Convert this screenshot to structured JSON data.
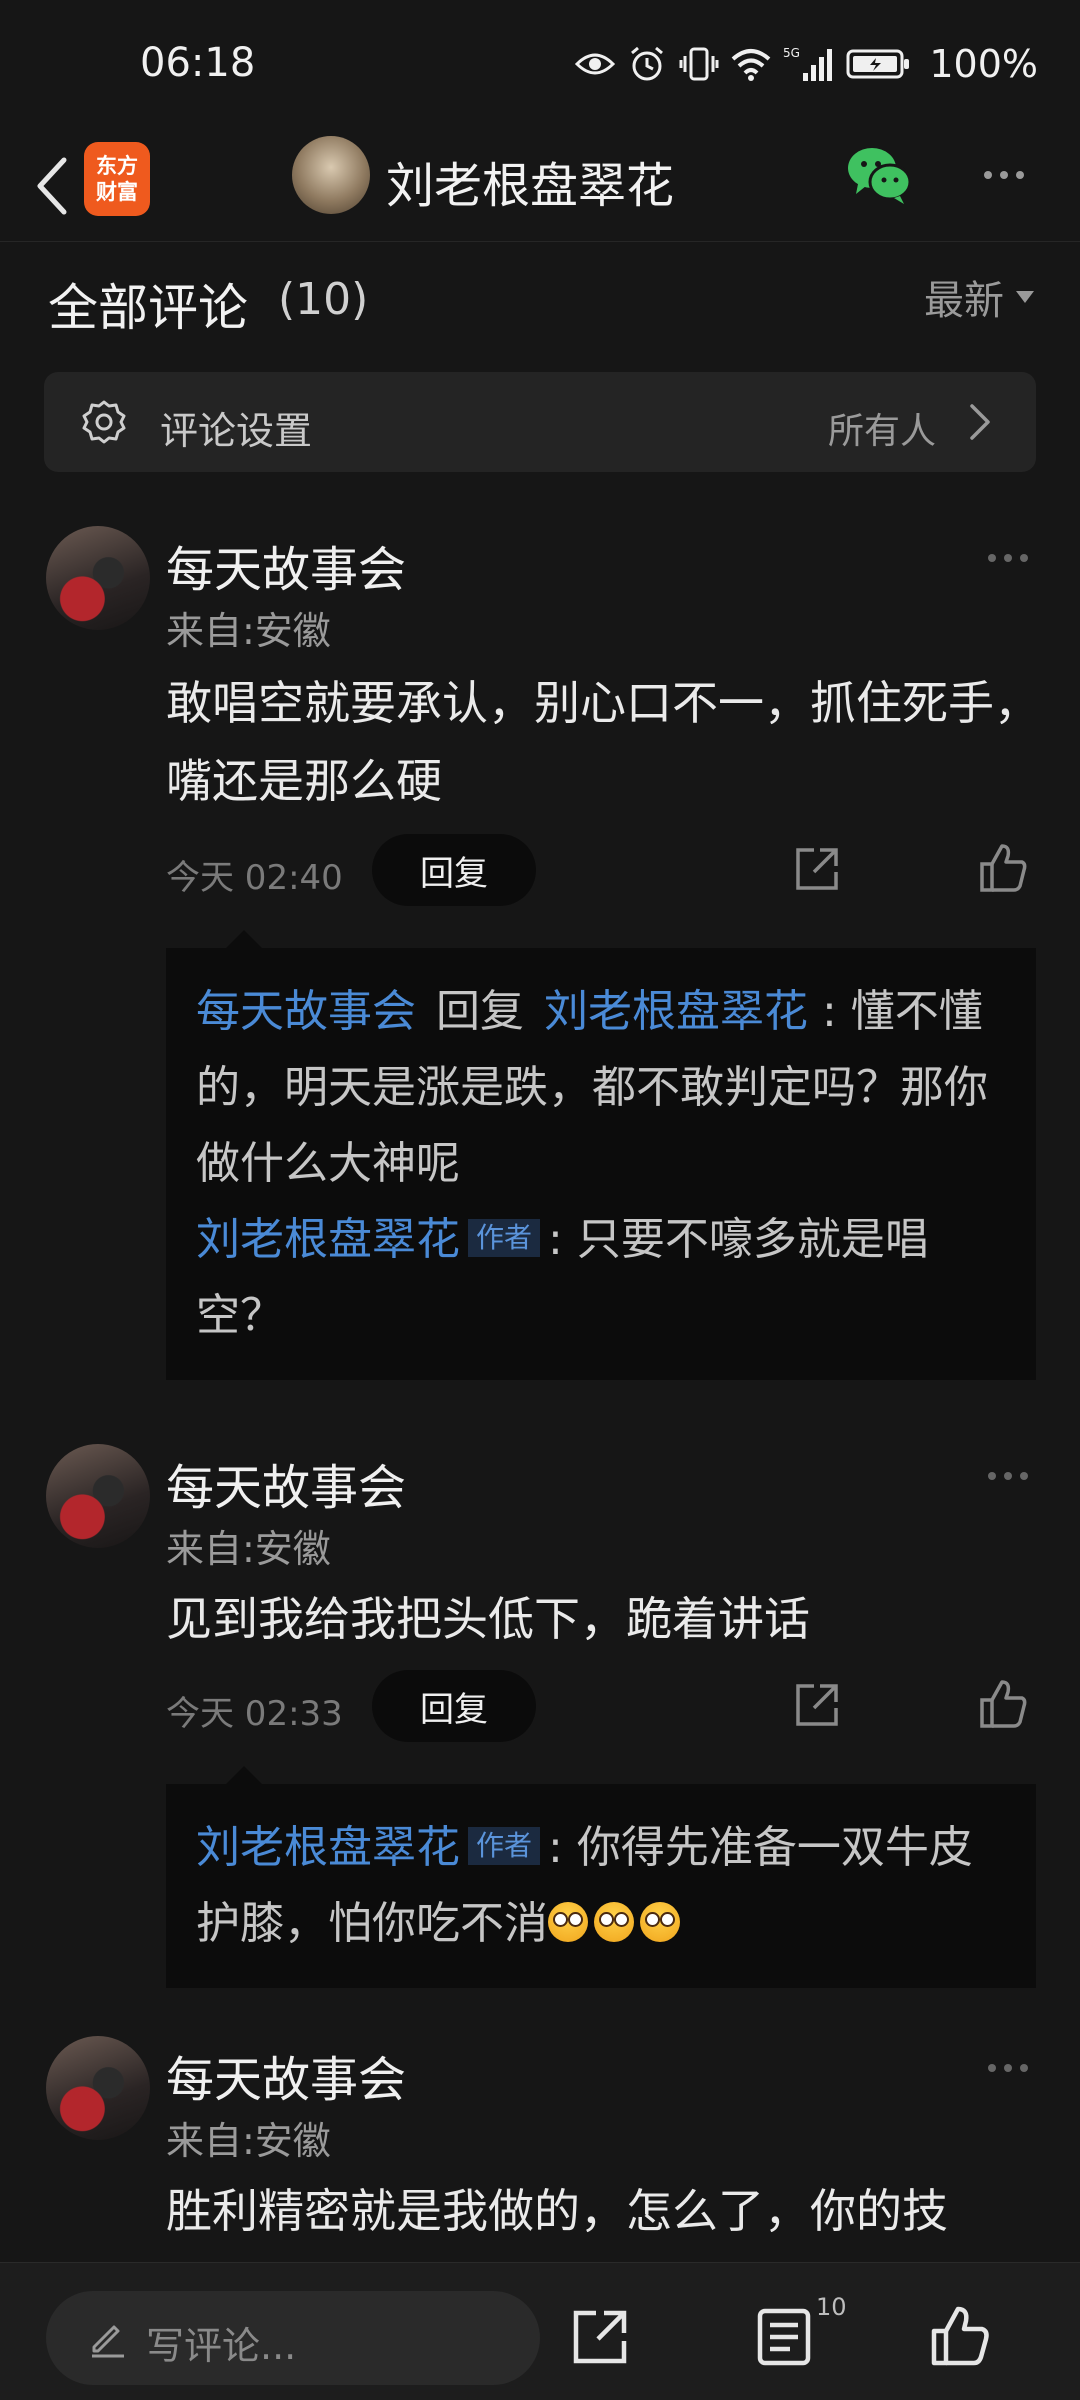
{
  "status_bar": {
    "time": "06:18",
    "battery": "100%",
    "network": "5G"
  },
  "header": {
    "brand_line1": "东方",
    "brand_line2": "财富",
    "title": "刘老根盘翠花"
  },
  "comments_header": {
    "title": "全部评论",
    "count": "(10)",
    "sort_label": "最新"
  },
  "settings": {
    "label": "评论设置",
    "value": "所有人"
  },
  "comments": [
    {
      "author": "每天故事会",
      "location": "来自:安徽",
      "text": "敢唱空就要承认，别心口不一，抓住死手，嘴还是那么硬",
      "time": "今天 02:40",
      "reply_label": "回复",
      "replies": [
        {
          "from": "每天故事会",
          "verb": "回复",
          "to": "刘老根盘翠花",
          "text": ": 懂不懂的，明天是涨是跌，都不敢判定吗？那你做什么大神呢"
        },
        {
          "from": "刘老根盘翠花",
          "badge": "作者",
          "text": ": 只要不嚎多就是唱空？"
        }
      ]
    },
    {
      "author": "每天故事会",
      "location": "来自:安徽",
      "text": "见到我给我把头低下，跪着讲话",
      "time": "今天 02:33",
      "reply_label": "回复",
      "replies": [
        {
          "from": "刘老根盘翠花",
          "badge": "作者",
          "text": ": 你得先准备一双牛皮护膝，怕你吃不消"
        }
      ]
    },
    {
      "author": "每天故事会",
      "location": "来自:安徽",
      "text": "胜利精密就是我做的，怎么了，你的技"
    }
  ],
  "bottom_bar": {
    "placeholder": "写评论...",
    "comment_count": "10"
  }
}
